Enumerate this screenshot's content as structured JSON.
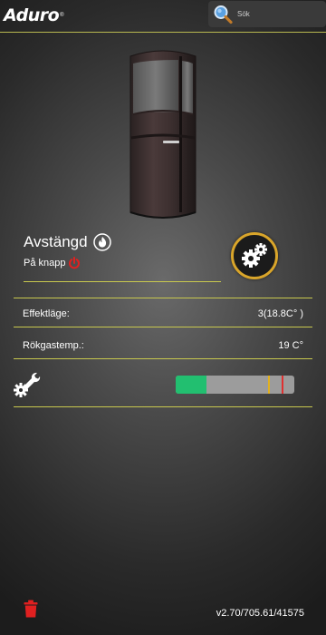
{
  "header": {
    "logo_text": "Aduro",
    "logo_mark": "®",
    "search": {
      "placeholder": "Sök",
      "icon": "search-icon"
    }
  },
  "status": {
    "title": "Avstängd",
    "subtitle": "På knapp",
    "title_icon": "flame-icon",
    "subtitle_icon": "power-icon"
  },
  "settings_button": {
    "icon": "gears-icon"
  },
  "rows": [
    {
      "label": "Effektläge:",
      "value": "3(18.8C° )"
    },
    {
      "label": "Rökgastemp.:",
      "value": "19 C°"
    }
  ],
  "maintenance": {
    "icon": "wrench-gear-icon",
    "progress": 0.26,
    "marker_yellow": 0.78,
    "marker_red": 0.89
  },
  "footer": {
    "delete_icon": "trash-icon",
    "version": "v2.70/705.61/41575"
  },
  "colors": {
    "accent_line": "#c8c84e",
    "progress_fill": "#22bf70",
    "marker_yellow": "#e0b020",
    "marker_red": "#e03030",
    "delete": "#e02020",
    "settings_ring": "#d9a52a"
  }
}
